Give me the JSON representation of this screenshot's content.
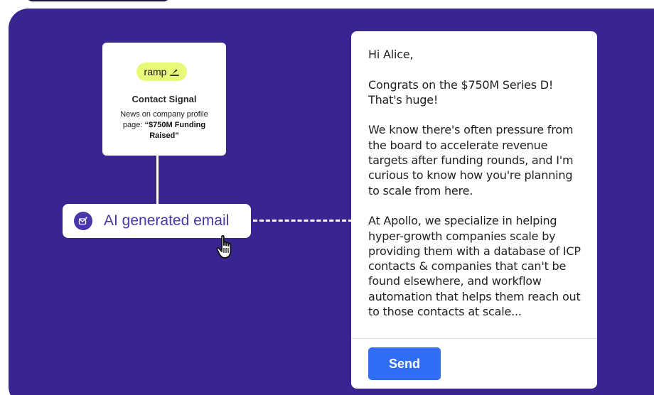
{
  "colors": {
    "panel_bg": "#3a2490",
    "ramp_badge": "#e8f97a",
    "accent_purple": "#4a36a8",
    "send_blue": "#2f6ef5"
  },
  "signal_card": {
    "logo_text": "ramp",
    "logo_icon": "ramp-mark-icon",
    "title": "Contact Signal",
    "body_prefix": "News on company profile page: ",
    "body_highlight": "“$750M Funding Raised”"
  },
  "ai_button": {
    "icon": "mail-sparkle-icon",
    "label": "AI generated email"
  },
  "email": {
    "greeting": "Hi Alice,",
    "paragraphs": [
      "Congrats on the $750M Series D! That's huge!",
      "We know there's often pressure from the board to accelerate revenue targets after funding rounds, and I'm curious to know how you're planning to scale from here.",
      "At Apollo, we specialize in helping hyper-growth companies scale by providing them with a database of ICP contacts & companies that can't be found elsewhere, and workflow automation that helps them reach out to those contacts at scale..."
    ],
    "send_label": "Send"
  }
}
